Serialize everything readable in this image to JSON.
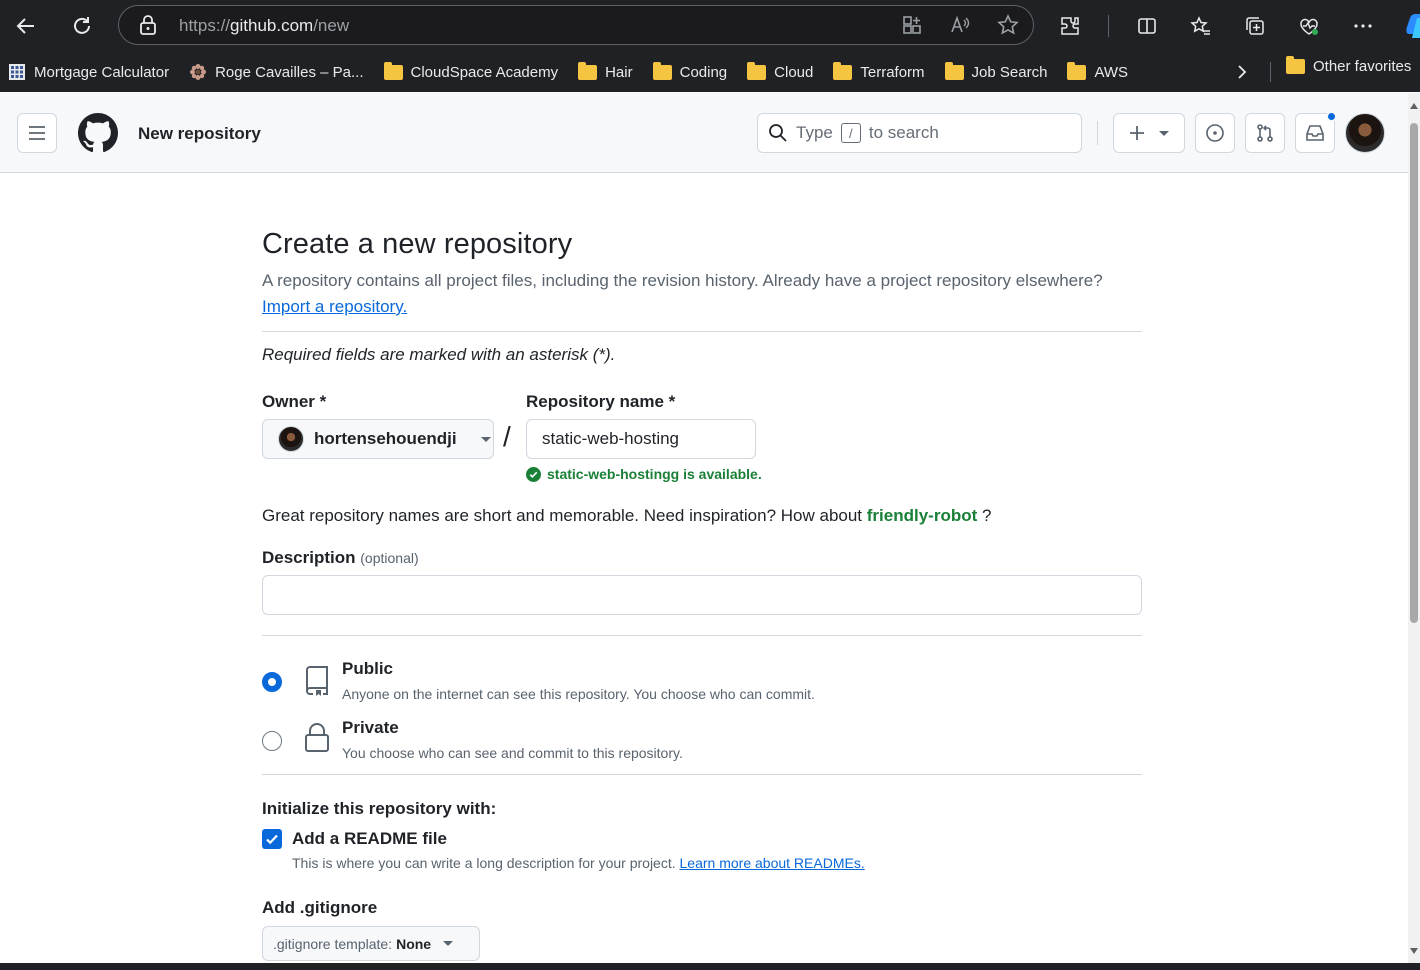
{
  "browser": {
    "url_prefix": "https://",
    "url_host": "github.com",
    "url_path": "/new"
  },
  "bookmarks": {
    "items": [
      {
        "label": "Mortgage Calculator",
        "icon": "calculator-icon"
      },
      {
        "label": "Roge Cavailles – Pa...",
        "icon": "flower-icon"
      },
      {
        "label": "CloudSpace Academy",
        "icon": "folder-icon"
      },
      {
        "label": "Hair",
        "icon": "folder-icon"
      },
      {
        "label": "Coding",
        "icon": "folder-icon"
      },
      {
        "label": "Cloud",
        "icon": "folder-icon"
      },
      {
        "label": "Terraform",
        "icon": "folder-icon"
      },
      {
        "label": "Job Search",
        "icon": "folder-icon"
      },
      {
        "label": "AWS",
        "icon": "folder-icon"
      }
    ],
    "other": "Other favorites"
  },
  "header": {
    "title": "New repository",
    "search_type": "Type",
    "search_key": "/",
    "search_rest": "to search"
  },
  "form": {
    "title": "Create a new repository",
    "subtitle": "A repository contains all project files, including the revision history. Already have a project repository elsewhere?",
    "import_link": "Import a repository.",
    "required_note": "Required fields are marked with an asterisk (*).",
    "owner_label": "Owner *",
    "owner_value": "hortensehouendji",
    "slash": "/",
    "repo_label": "Repository name *",
    "repo_value": "static-web-hosting",
    "availability": "static-web-hostingg is available.",
    "inspiration_pre": "Great repository names are short and memorable. Need inspiration? How about",
    "inspiration_suggest": "friendly-robot",
    "inspiration_post": "?",
    "description_label": "Description",
    "description_optional": "(optional)",
    "description_value": "",
    "visibility": {
      "selected": "public",
      "public_title": "Public",
      "public_desc": "Anyone on the internet can see this repository. You choose who can commit.",
      "private_title": "Private",
      "private_desc": "You choose who can see and commit to this repository."
    },
    "init_label": "Initialize this repository with:",
    "readme_checked": true,
    "readme_label": "Add a README file",
    "readme_desc": "This is where you can write a long description for your project.",
    "readme_link": "Learn more about READMEs.",
    "gitignore_label": "Add .gitignore",
    "gitignore_prefix": ".gitignore template:",
    "gitignore_value": "None"
  },
  "colors": {
    "accent": "#0969da",
    "success": "#1a7f37",
    "chrome_bg": "#202124",
    "folder": "#f5c542"
  }
}
